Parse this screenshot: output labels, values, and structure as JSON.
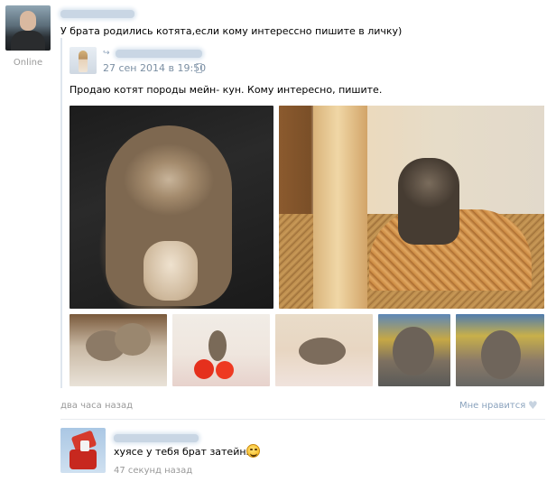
{
  "post": {
    "author_status": "Online",
    "text": "У брата родились котята,если кому интерессно пишите в личку)",
    "time_ago": "два часа назад",
    "like_label": "Мне нравится"
  },
  "repost": {
    "date": "27 сен 2014 в 19:50",
    "text": "Продаю котят породы мейн- кун. Кому интересно, пишите."
  },
  "photos": {
    "large": [
      "kitten-sleeping",
      "kitten-on-basket"
    ],
    "thumbnails": [
      "kittens-on-blanket",
      "kitten-with-apples",
      "kitten-lying",
      "kitten-front",
      "kitten-sitting"
    ]
  },
  "comment": {
    "text": "хуясе у тебя брат затейник",
    "time": "47 секунд назад",
    "emoji_icon": "laughing-face-icon"
  },
  "colors": {
    "link": "#2b587a",
    "date": "#7b8fa3",
    "muted": "#999999",
    "like": "#8aa2bd"
  }
}
